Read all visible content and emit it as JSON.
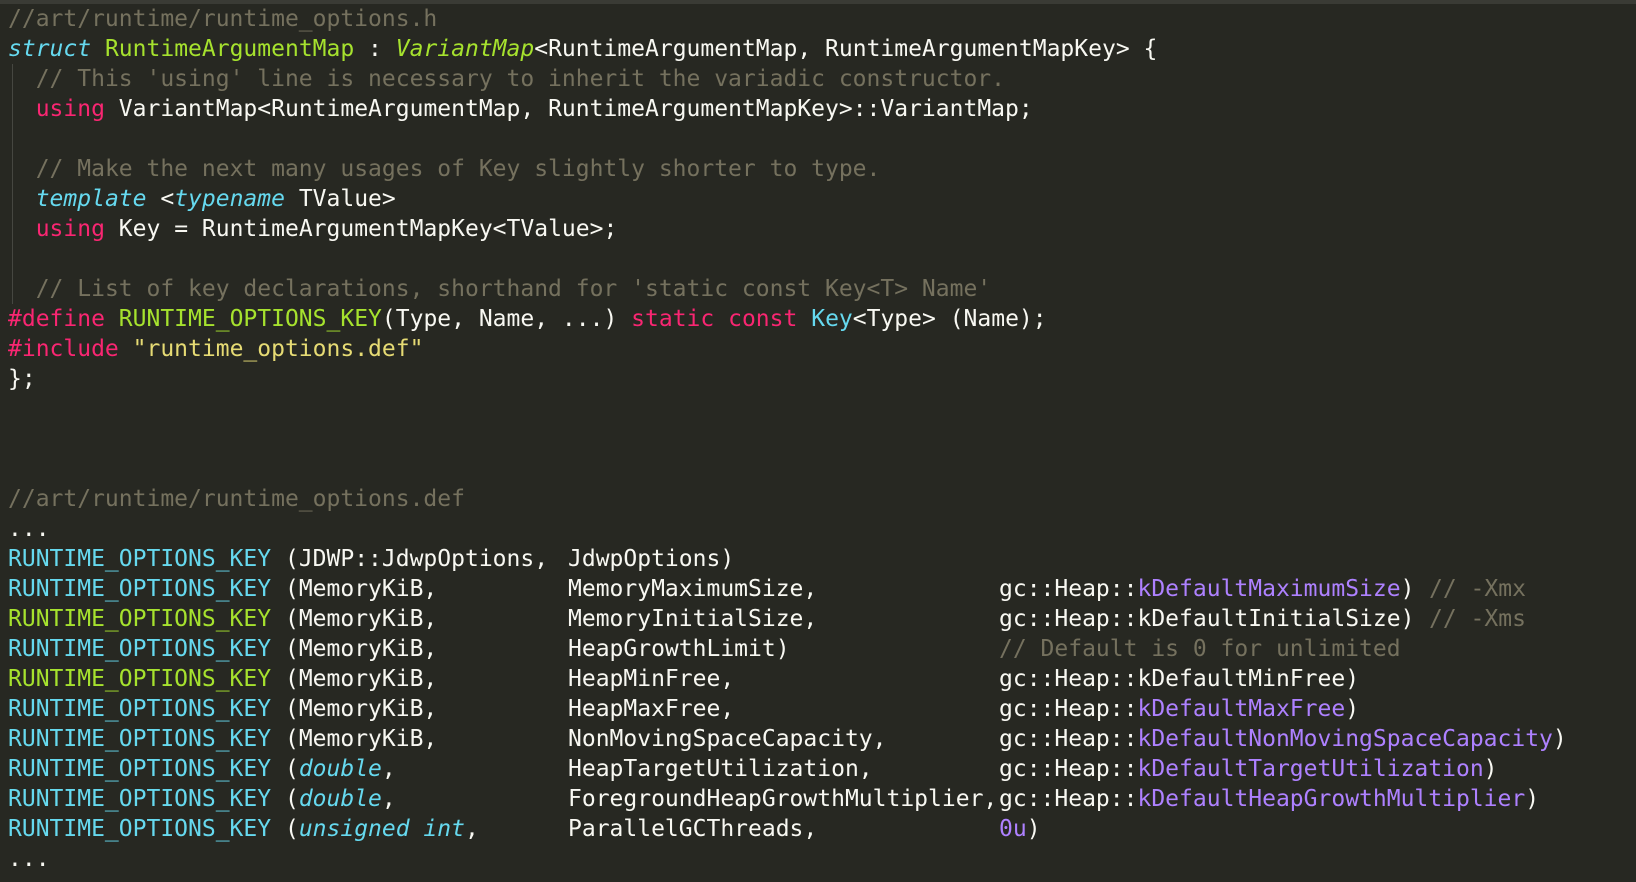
{
  "header": {
    "path": "//art/runtime/runtime_options.h",
    "struct_kw": "struct",
    "struct_name": "RuntimeArgumentMap",
    "sep": " : ",
    "base": "VariantMap",
    "base_args": "<RuntimeArgumentMap, RuntimeArgumentMapKey> {",
    "comment1": "// This 'using' line is necessary to inherit the variadic constructor.",
    "using_kw": "using",
    "using_rest": " VariantMap<RuntimeArgumentMap, RuntimeArgumentMapKey>::VariantMap;",
    "comment2": "// Make the next many usages of Key slightly shorter to type.",
    "template_kw": "template",
    "lt": " <",
    "typename_kw": "typename",
    "tvalue": " TValue>",
    "using2_rest": " Key = RuntimeArgumentMapKey<TValue>;",
    "comment3": "// List of key declarations, shorthand for 'static const Key<T> Name'",
    "define_kw": "#define",
    "space": " ",
    "macro": "RUNTIME_OPTIONS_KEY",
    "define_params": "(Type, Name, ...) ",
    "static_kw": "static",
    "const_kw": "const",
    "key_type": "Key",
    "define_tail": "<Type> (Name);",
    "include_kw": "#include",
    "include_file": "\"runtime_options.def\"",
    "close": "};"
  },
  "def": {
    "path": "//art/runtime/runtime_options.def",
    "ellipsis": "...",
    "ellipsis_end": "...",
    "rows": [
      {
        "macro": "RUNTIME_OPTIONS_KEY",
        "open": " (",
        "type": "JDWP::JdwpOptions,",
        "name": "JdwpOptions)",
        "ns": "",
        "value": "",
        "value_tail": "",
        "comment": ""
      },
      {
        "macro": "RUNTIME_OPTIONS_KEY",
        "open": " (",
        "type": "MemoryKiB,",
        "name": "MemoryMaximumSize,",
        "ns": "gc::Heap::",
        "value": "kDefaultMaximumSize",
        "value_tail": ")",
        "comment": "// -Xmx"
      },
      {
        "macro": "RUNTIME_OPTIONS_KEY",
        "open": " (",
        "type": "MemoryKiB,",
        "name": "MemoryInitialSize,",
        "ns": "gc::Heap::",
        "value": "kDefaultInitialSize",
        "value_tail": ")",
        "comment": "// -Xms"
      },
      {
        "macro": "RUNTIME_OPTIONS_KEY",
        "open": " (",
        "type": "MemoryKiB,",
        "name": "HeapGrowthLimit)",
        "ns": "",
        "value": "",
        "value_tail": "",
        "comment": "// Default is 0 for unlimited"
      },
      {
        "macro": "RUNTIME_OPTIONS_KEY",
        "open": " (",
        "type": "MemoryKiB,",
        "name": "HeapMinFree,",
        "ns": "gc::Heap::",
        "value": "kDefaultMinFree",
        "value_tail": ")",
        "comment": ""
      },
      {
        "macro": "RUNTIME_OPTIONS_KEY",
        "open": " (",
        "type": "MemoryKiB,",
        "name": "HeapMaxFree,",
        "ns": "gc::Heap::",
        "value": "kDefaultMaxFree",
        "value_tail": ")",
        "comment": ""
      },
      {
        "macro": "RUNTIME_OPTIONS_KEY",
        "open": " (",
        "type": "MemoryKiB,",
        "name": "NonMovingSpaceCapacity,",
        "ns": "gc::Heap::",
        "value": "kDefaultNonMovingSpaceCapacity",
        "value_tail": ")",
        "comment": ""
      },
      {
        "macro": "RUNTIME_OPTIONS_KEY",
        "open": " (",
        "type": "double",
        "type_tail": ",",
        "name": "HeapTargetUtilization,",
        "ns": "gc::Heap::",
        "value": "kDefaultTargetUtilization",
        "value_tail": ")",
        "comment": ""
      },
      {
        "macro": "RUNTIME_OPTIONS_KEY",
        "open": " (",
        "type": "double",
        "type_tail": ",",
        "name": "ForegroundHeapGrowthMultiplier,",
        "ns": "gc::Heap::",
        "value": "kDefaultHeapGrowthMultiplier",
        "value_tail": ")",
        "comment": ""
      },
      {
        "macro": "RUNTIME_OPTIONS_KEY",
        "open": " (",
        "type": "unsigned int",
        "type_tail": ",",
        "name": "ParallelGCThreads,",
        "ns": "",
        "value": "0u",
        "value_tail": ")",
        "comment": ""
      }
    ]
  },
  "colors": {
    "background": "#272822",
    "text": "#f8f8f2",
    "comment": "#75715e",
    "keyword": "#f92672",
    "storage": "#66d9ef",
    "entity": "#a6e22e",
    "string": "#e6db74",
    "constant": "#ae81ff"
  }
}
